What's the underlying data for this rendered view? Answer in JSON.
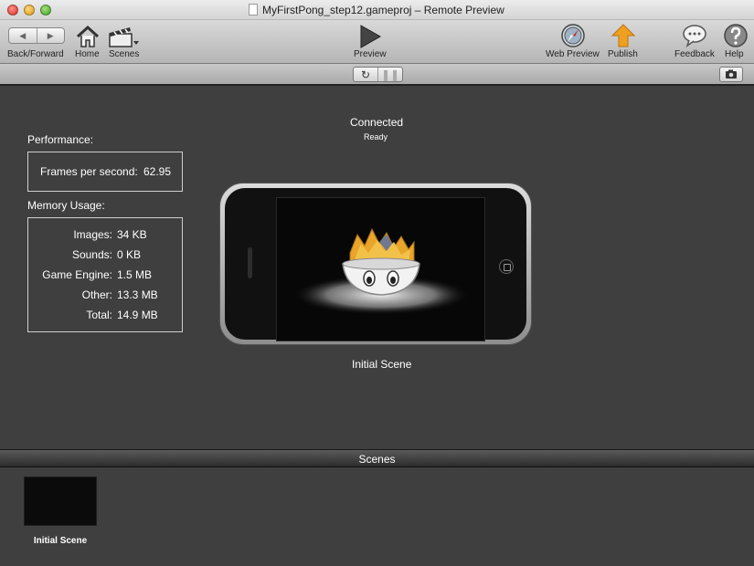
{
  "window": {
    "title": "MyFirstPong_step12.gameproj – Remote Preview"
  },
  "toolbar": {
    "back_forward_label": "Back/Forward",
    "home_label": "Home",
    "scenes_label": "Scenes",
    "preview_label": "Preview",
    "web_preview_label": "Web Preview",
    "publish_label": "Publish",
    "feedback_label": "Feedback",
    "help_label": "Help",
    "back_glyph": "◀",
    "forward_glyph": "▶"
  },
  "controls": {
    "refresh_glyph": "↻",
    "pause_glyph": "❚❚"
  },
  "status": {
    "connection": "Connected",
    "state": "Ready"
  },
  "performance": {
    "heading": "Performance:",
    "fps_label": "Frames per second:",
    "fps_value": "62.95"
  },
  "memory": {
    "heading": "Memory Usage:",
    "rows": [
      {
        "label": "Images:",
        "value": "34 KB"
      },
      {
        "label": "Sounds:",
        "value": "0 KB"
      },
      {
        "label": "Game Engine:",
        "value": "1.5 MB"
      },
      {
        "label": "Other:",
        "value": "13.3 MB"
      },
      {
        "label": "Total:",
        "value": "14.9 MB"
      }
    ]
  },
  "device": {
    "scene_name": "Initial Scene"
  },
  "scenes_panel": {
    "title": "Scenes",
    "items": [
      {
        "label": "Initial Scene"
      }
    ]
  },
  "colors": {
    "background": "#3f3f3f",
    "publish_accent": "#f0a020",
    "text_on_dark": "#ffffff"
  }
}
